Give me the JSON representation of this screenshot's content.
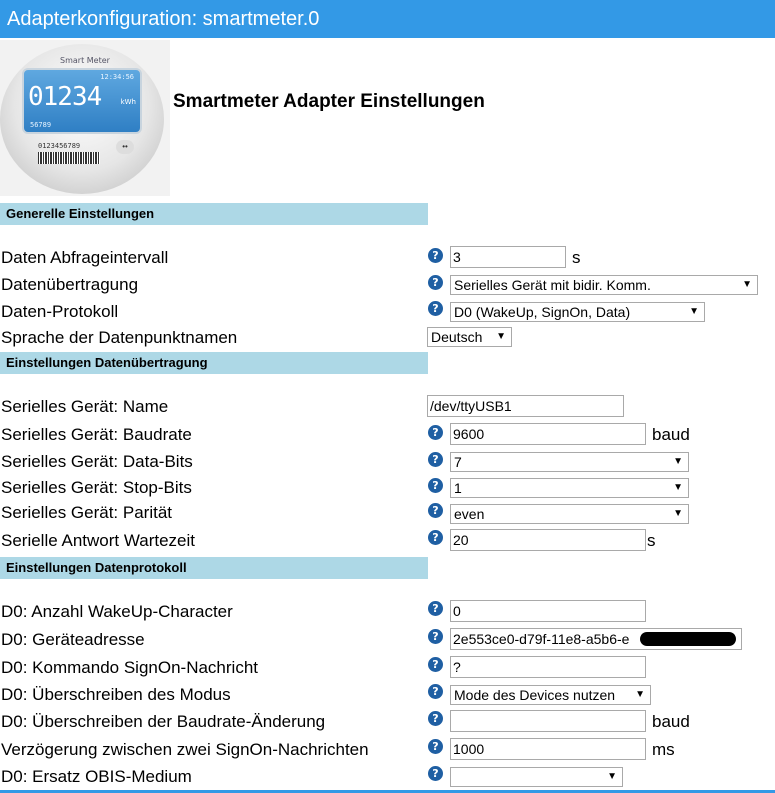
{
  "window": {
    "title": "Adapterkonfiguration: smartmeter.0"
  },
  "logo": {
    "brand": "Smart Meter",
    "time": "12:34:56",
    "digits": "01234",
    "unit": "kWh",
    "small": "56789",
    "serial": "0123456789",
    "dots": "••"
  },
  "page_title": "Smartmeter Adapter Einstellungen",
  "sections": {
    "general": "Generelle Einstellungen",
    "transfer": "Einstellungen Datenübertragung",
    "protocol": "Einstellungen Datenprotokoll"
  },
  "help_glyph": "?",
  "fields": {
    "interval": {
      "label": "Daten Abfrageintervall",
      "value": "3",
      "unit": "s"
    },
    "transmission": {
      "label": "Datenübertragung",
      "value": "Serielles Gerät mit bidir. Komm."
    },
    "protocol": {
      "label": "Daten-Protokoll",
      "value": "D0 (WakeUp, SignOn, Data)"
    },
    "language": {
      "label": "Sprache der Datenpunktnamen",
      "value": "Deutsch"
    },
    "serial_name": {
      "label": "Serielles Gerät: Name",
      "value": "/dev/ttyUSB1"
    },
    "baudrate": {
      "label": "Serielles Gerät: Baudrate",
      "value": "9600",
      "unit": "baud"
    },
    "databits": {
      "label": "Serielles Gerät: Data-Bits",
      "value": "7"
    },
    "stopbits": {
      "label": "Serielles Gerät: Stop-Bits",
      "value": "1"
    },
    "parity": {
      "label": "Serielles Gerät: Parität",
      "value": "even"
    },
    "wait": {
      "label": "Serielle Antwort Wartezeit",
      "value": "20",
      "unit": "s"
    },
    "wakeup": {
      "label": "D0: Anzahl WakeUp-Character",
      "value": "0"
    },
    "address": {
      "label": "D0: Geräteadresse",
      "value": "2e553ce0-d79f-11e8-a5b6-e"
    },
    "signon": {
      "label": "D0: Kommando SignOn-Nachricht",
      "value": "?"
    },
    "mode": {
      "label": "D0: Überschreiben des Modus",
      "value": "Mode des Devices nutzen"
    },
    "baudchange": {
      "label": "D0: Überschreiben der Baudrate-Änderung",
      "value": "",
      "unit": "baud"
    },
    "delay": {
      "label": "Verzögerung zwischen zwei SignOn-Nachrichten",
      "value": "1000",
      "unit": "ms"
    },
    "obis": {
      "label": "D0: Ersatz OBIS-Medium",
      "value": ""
    }
  },
  "colors": {
    "titlebar": "#3399e6",
    "section": "#add8e6",
    "help": "#1f5fa3"
  }
}
